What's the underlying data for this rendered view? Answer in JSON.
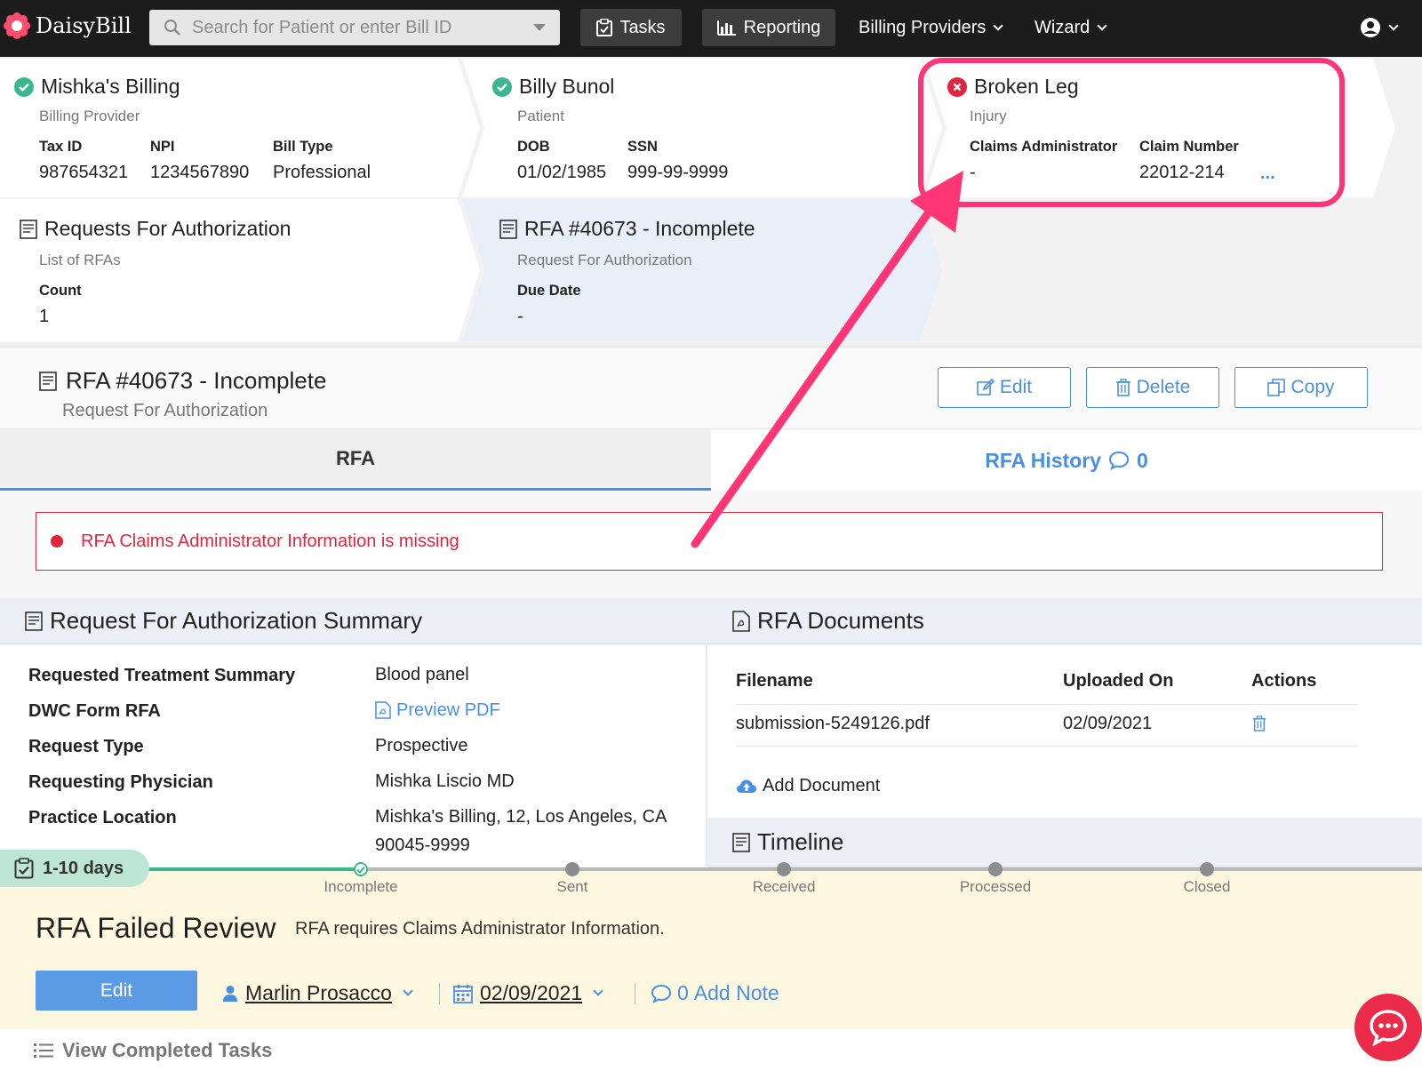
{
  "colors": {
    "accent": "#4a90e2",
    "error": "#e0263f",
    "success": "#3bb78f",
    "annotation": "#ff3576",
    "navbar": "#1c1c1c"
  },
  "navbar": {
    "logo": "DaisyBill",
    "search_placeholder": "Search for Patient or enter Bill ID",
    "tasks": "Tasks",
    "reporting": "Reporting",
    "billing_providers": "Billing Providers",
    "wizard": "Wizard"
  },
  "crumbs": {
    "provider": {
      "title": "Mishka's Billing",
      "sub": "Billing Provider",
      "status": "complete",
      "fields": [
        {
          "label": "Tax ID",
          "value": "987654321"
        },
        {
          "label": "NPI",
          "value": "1234567890"
        },
        {
          "label": "Bill Type",
          "value": "Professional"
        }
      ]
    },
    "patient": {
      "title": "Billy Bunol",
      "sub": "Patient",
      "status": "complete",
      "fields": [
        {
          "label": "DOB",
          "value": "01/02/1985"
        },
        {
          "label": "SSN",
          "value": "999-99-9999"
        }
      ]
    },
    "injury": {
      "title": "Broken Leg",
      "sub": "Injury",
      "status": "error",
      "fields": [
        {
          "label": "Claims Administrator",
          "value": "-"
        },
        {
          "label": "Claim Number",
          "value": "22012-214"
        }
      ],
      "more": "..."
    },
    "rfas": {
      "title": "Requests For Authorization",
      "sub": "List of RFAs",
      "fields": [
        {
          "label": "Count",
          "value": "1"
        }
      ]
    },
    "rfa": {
      "title": "RFA #40673 - Incomplete",
      "sub": "Request For Authorization",
      "fields": [
        {
          "label": "Due Date",
          "value": "-"
        }
      ]
    }
  },
  "header": {
    "title": "RFA #40673 - Incomplete",
    "sub": "Request For Authorization",
    "edit": "Edit",
    "delete": "Delete",
    "copy": "Copy"
  },
  "tabs": {
    "rfa": "RFA",
    "history": "RFA History",
    "history_count": "0"
  },
  "alert": "RFA Claims Administrator Information is missing",
  "summary": {
    "title": "Request For Authorization Summary",
    "rows": [
      {
        "label": "Requested Treatment Summary",
        "value": "Blood panel"
      },
      {
        "label": "DWC Form RFA",
        "value": "Preview PDF"
      },
      {
        "label": "Request Type",
        "value": "Prospective"
      },
      {
        "label": "Requesting Physician",
        "value": "Mishka Liscio MD"
      },
      {
        "label": "Practice Location",
        "value": "Mishka's Billing, 12, Los Angeles, CA",
        "value2": "90045-9999"
      }
    ]
  },
  "documents": {
    "title": "RFA Documents",
    "headers": [
      "Filename",
      "Uploaded On",
      "Actions"
    ],
    "rows": [
      {
        "filename": "submission-5249126.pdf",
        "uploaded": "02/09/2021"
      }
    ],
    "add": "Add Document"
  },
  "timeline": {
    "title": "Timeline"
  },
  "task": {
    "days": "1-10 days",
    "stages": [
      "Incomplete",
      "Sent",
      "Received",
      "Processed",
      "Closed"
    ],
    "current_stage": "Incomplete",
    "title": "RFA Failed Review",
    "desc": "RFA requires Claims Administrator Information.",
    "edit": "Edit",
    "assignee": "Marlin Prosacco",
    "date": "02/09/2021",
    "note_count": "0",
    "note_label": "Add Note",
    "completed": "View Completed Tasks"
  }
}
